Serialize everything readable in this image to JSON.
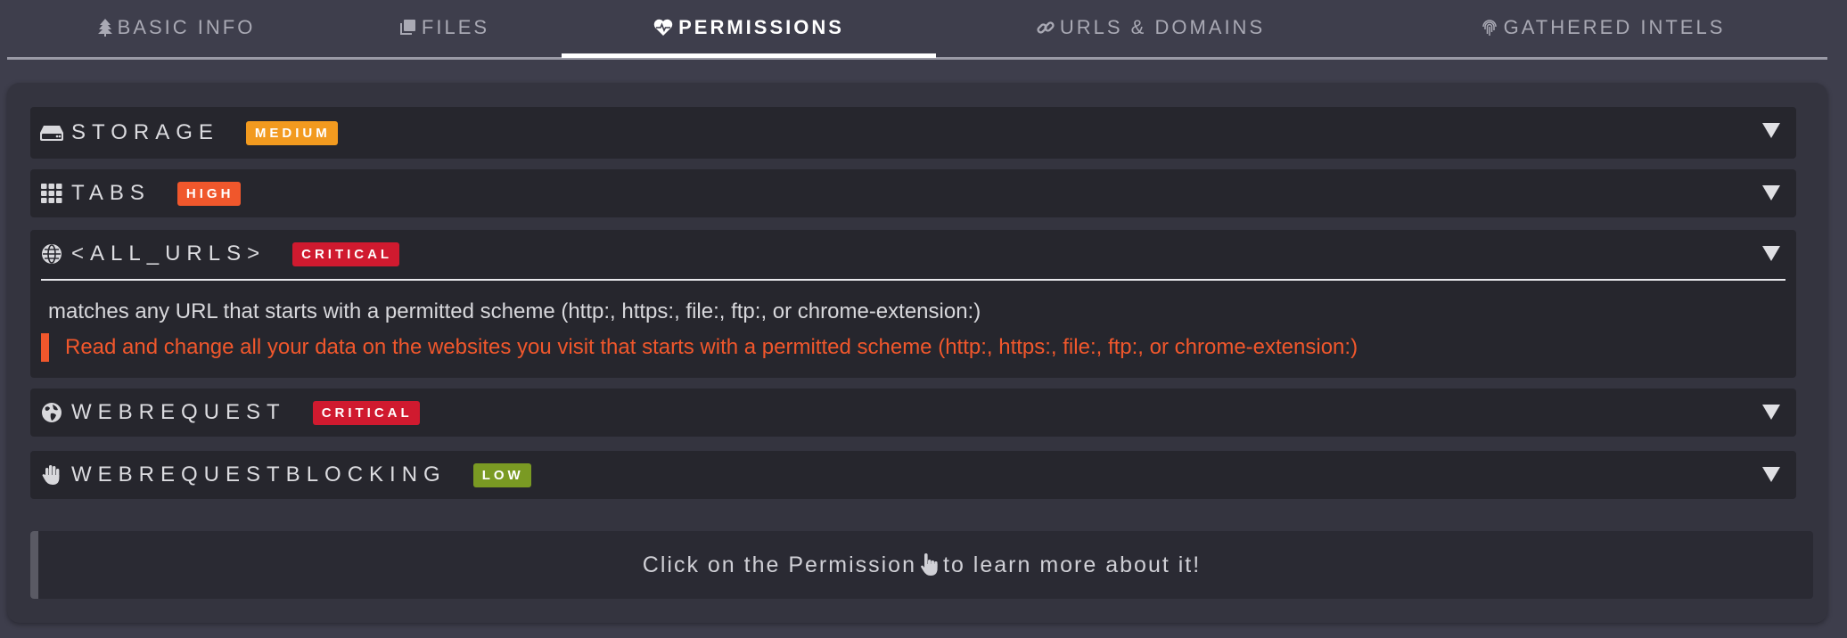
{
  "tabs": [
    {
      "label": "Basic Info",
      "icon": "tree-icon",
      "active": false
    },
    {
      "label": "Files",
      "icon": "files-icon",
      "active": false
    },
    {
      "label": "Permissions",
      "icon": "heart-pulse-icon",
      "active": true
    },
    {
      "label": "URLs & Domains",
      "icon": "link-icon",
      "active": false
    },
    {
      "label": "Gathered Intels",
      "icon": "fingerprint-icon",
      "active": false
    }
  ],
  "permissions": [
    {
      "name": "STORAGE",
      "icon": "hard-drive-icon",
      "severity": "MEDIUM",
      "expanded": false
    },
    {
      "name": "TABS",
      "icon": "grid-icon",
      "severity": "HIGH",
      "expanded": false
    },
    {
      "name": "<ALL_URLS>",
      "icon": "globe-icon",
      "severity": "CRITICAL",
      "expanded": true,
      "description": "matches any URL that starts with a permitted scheme (http:, https:, file:, ftp:, or chrome-extension:)",
      "warning": "Read and change all your data on the websites you visit that starts with a permitted scheme (http:, https:, file:, ftp:, or chrome-extension:)"
    },
    {
      "name": "WEBREQUEST",
      "icon": "earth-icon",
      "severity": "CRITICAL",
      "expanded": false
    },
    {
      "name": "WEBREQUESTBLOCKING",
      "icon": "hand-icon",
      "severity": "LOW",
      "expanded": false
    }
  ],
  "hint": {
    "before": "Click on the Permission",
    "icon": "hand-pointer-icon",
    "after": "to learn more about it!"
  },
  "colors": {
    "medium": "#f29a1f",
    "high": "#f0572c",
    "critical": "#d01a2f",
    "low": "#7a9a23",
    "warning_text": "#f0572c"
  }
}
